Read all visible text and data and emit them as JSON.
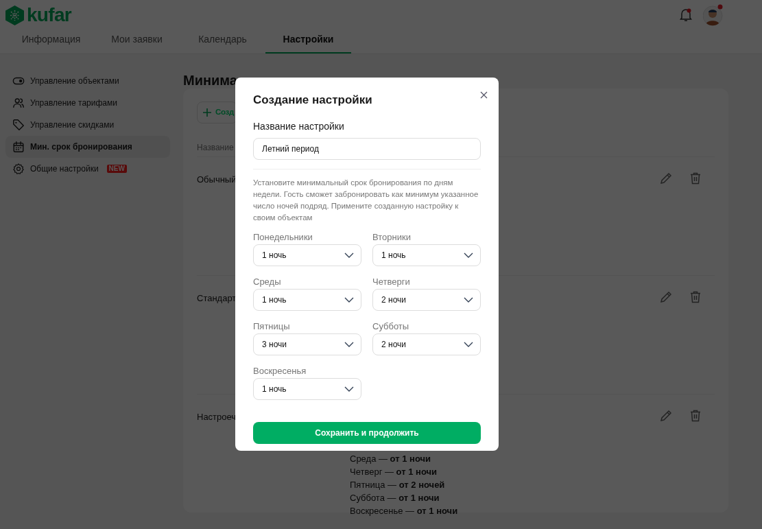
{
  "header": {
    "logo": "kufar"
  },
  "tabs": [
    {
      "label": "Информация",
      "selected": false
    },
    {
      "label": "Мои заявки",
      "selected": false
    },
    {
      "label": "Календарь",
      "selected": false
    },
    {
      "label": "Настройки",
      "selected": true
    }
  ],
  "sidebar": {
    "items": [
      {
        "label": "Управление объектами",
        "selected": false
      },
      {
        "label": "Управление тарифами",
        "selected": false
      },
      {
        "label": "Управление скидками",
        "selected": false
      },
      {
        "label": "Мин. срок бронирования",
        "selected": true
      },
      {
        "label": "Общие настройки",
        "selected": false,
        "badge": "NEW"
      }
    ]
  },
  "content": {
    "heading": "Минима",
    "create_button": "Созд",
    "column_header": "Название",
    "rows": [
      {
        "name": "Обычный",
        "details": []
      },
      {
        "name": "Стандарт",
        "details": []
      },
      {
        "name": "Настроеч",
        "details": [
          "Среда — **от 1 ночи**",
          "Четверг — **от 1 ночи**",
          "Пятница — **от 2 ночей**",
          "Суббота — **от 1 ночи**",
          "Воскресенье — **от 1 ночи**"
        ]
      }
    ]
  },
  "modal": {
    "title": "Создание настройки",
    "name_label": "Название настройки",
    "name_value": "Летний период",
    "description": "Установите минимальный срок бронирования по дням недели. Гость сможет забронировать как минимум указанное число ночей подряд. Примените созданную настройку к своим объектам",
    "days": [
      {
        "label": "Понедельники",
        "value": "1 ночь"
      },
      {
        "label": "Вторники",
        "value": "1 ночь"
      },
      {
        "label": "Среды",
        "value": "1 ночь"
      },
      {
        "label": "Четверги",
        "value": "2 ночи"
      },
      {
        "label": "Пятницы",
        "value": "3 ночи"
      },
      {
        "label": "Субботы",
        "value": "2 ночи"
      },
      {
        "label": "Воскресенья",
        "value": "1 ночь"
      }
    ],
    "submit": "Сохранить и продолжить"
  }
}
